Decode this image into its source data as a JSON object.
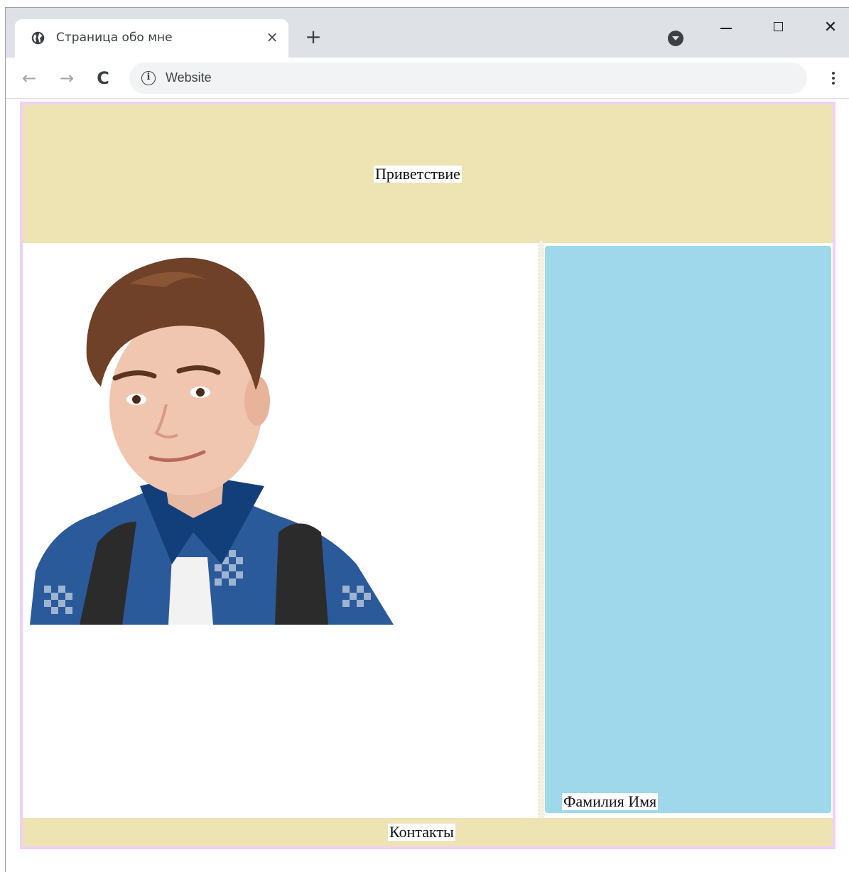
{
  "browser": {
    "tab_title": "Страница обо мне",
    "tab_close": "×",
    "new_tab": "+",
    "address": "Website",
    "info_icon": "i",
    "back_glyph": "←",
    "forward_glyph": "→",
    "reload_glyph": "C",
    "close_glyph": "✕",
    "icons": {
      "favicon": "globe-icon",
      "profile": "profile-dropdown-icon",
      "menu": "kebab-menu-icon"
    }
  },
  "page": {
    "greeting": "Приветствие",
    "full_name": "Фамилия Имя",
    "contacts": "Контакты",
    "colors": {
      "border": "#efd0f7",
      "header_footer_bg": "#eee3b3",
      "name_panel_bg": "#9ed8ea"
    }
  }
}
